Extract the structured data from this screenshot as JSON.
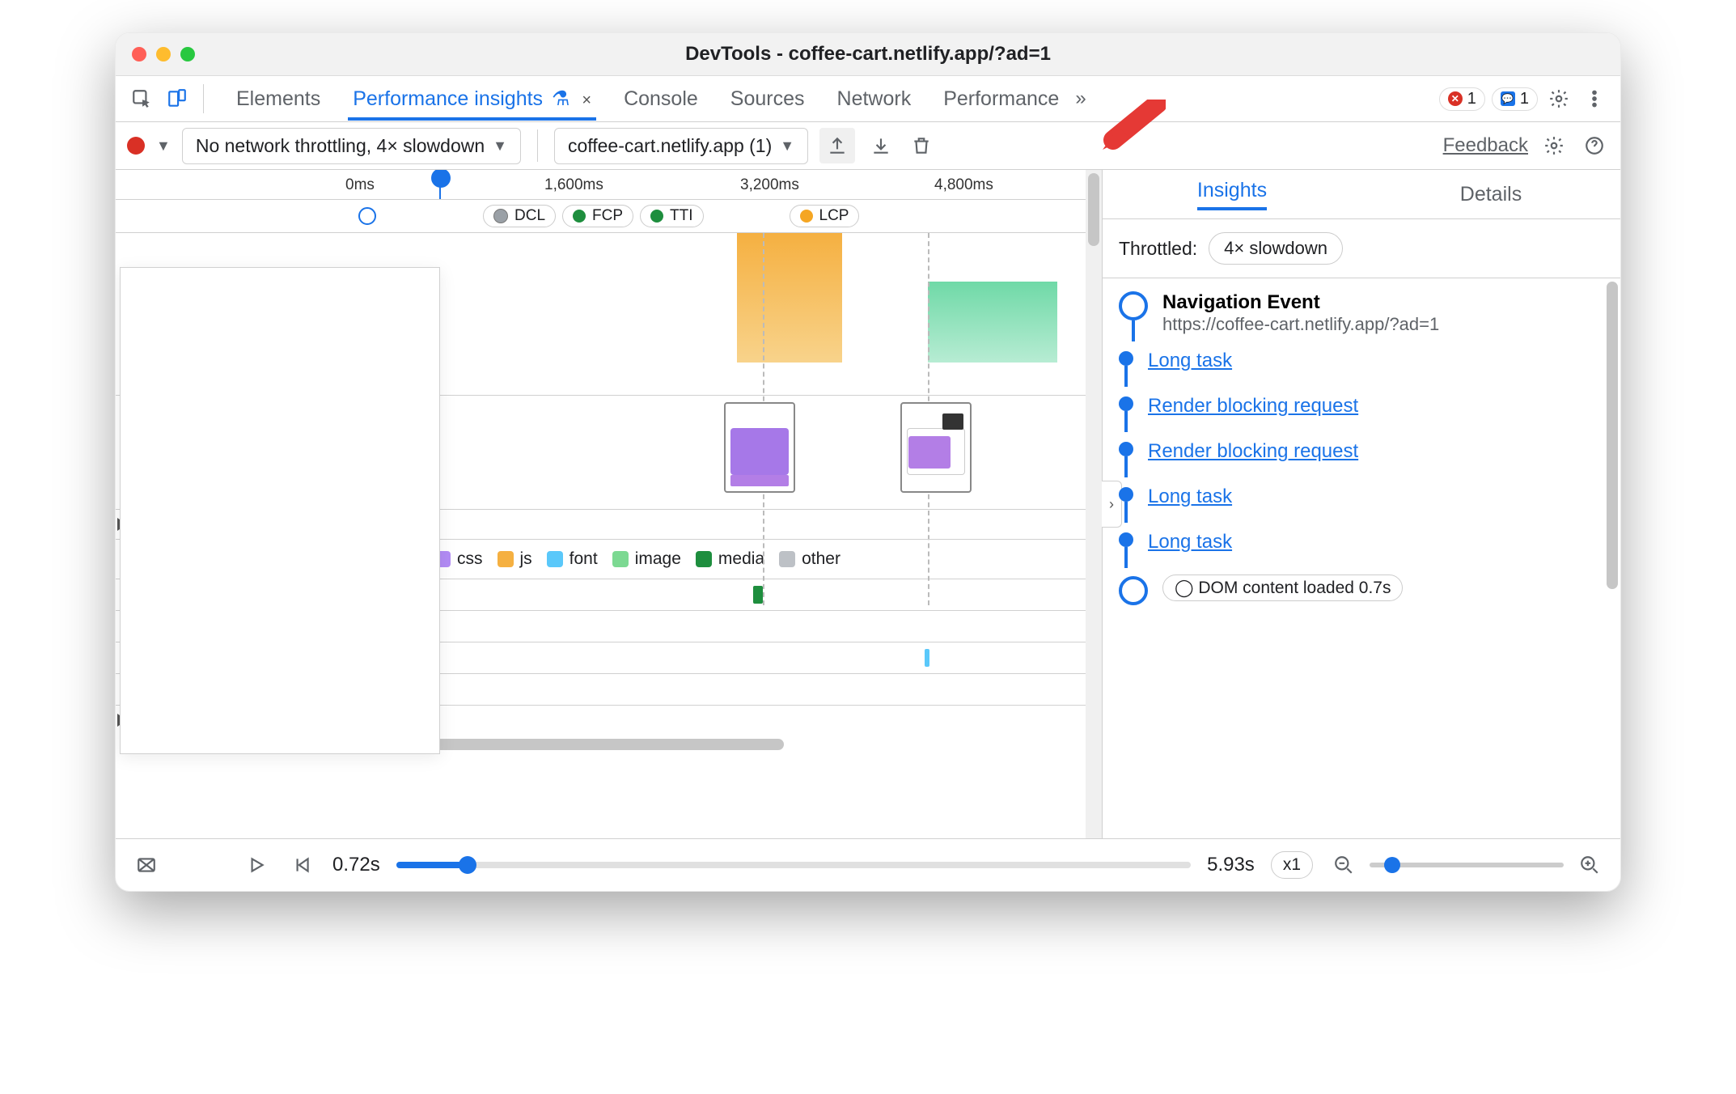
{
  "window": {
    "title": "DevTools - coffee-cart.netlify.app/?ad=1"
  },
  "tabs": {
    "items": [
      "Elements",
      "Performance insights",
      "Console",
      "Sources",
      "Network",
      "Performance"
    ],
    "active_index": 1,
    "close_label": "×",
    "overflow_glyph": "»"
  },
  "counters": {
    "errors": "1",
    "issues": "1"
  },
  "subbar": {
    "throttle_select": "No network throttling, 4× slowdown",
    "page_select": "coffee-cart.netlify.app (1)",
    "feedback": "Feedback"
  },
  "ruler": {
    "t0": "0ms",
    "t1": "1,600ms",
    "t2": "3,200ms",
    "t3": "4,800ms"
  },
  "chips": [
    {
      "label": "DCL",
      "color": "#9aa0a6"
    },
    {
      "label": "FCP",
      "color": "#1e8e3e"
    },
    {
      "label": "TTI",
      "color": "#1e8e3e"
    },
    {
      "label": "LCP",
      "color": "#f5a623"
    }
  ],
  "legend": [
    {
      "label": "css",
      "color": "#b38cf5"
    },
    {
      "label": "js",
      "color": "#f5b041"
    },
    {
      "label": "font",
      "color": "#5ac8fa"
    },
    {
      "label": "image",
      "color": "#7cd992"
    },
    {
      "label": "media",
      "color": "#1e8e3e"
    },
    {
      "label": "other",
      "color": "#bdc1c6"
    }
  ],
  "right": {
    "tabs": {
      "insights": "Insights",
      "details": "Details"
    },
    "throttle_label": "Throttled:",
    "throttle_value": "4× slowdown",
    "nav_title": "Navigation Event",
    "nav_url": "https://coffee-cart.netlify.app/?ad=1",
    "items": [
      "Long task",
      "Render blocking request",
      "Render blocking request",
      "Long task",
      "Long task"
    ],
    "dcl": "DOM content loaded 0.7s"
  },
  "footer": {
    "t_current": "0.72s",
    "t_end": "5.93s",
    "speed": "x1"
  },
  "colors": {
    "orange": "#f5b041",
    "teal": "#6fd9a7"
  }
}
